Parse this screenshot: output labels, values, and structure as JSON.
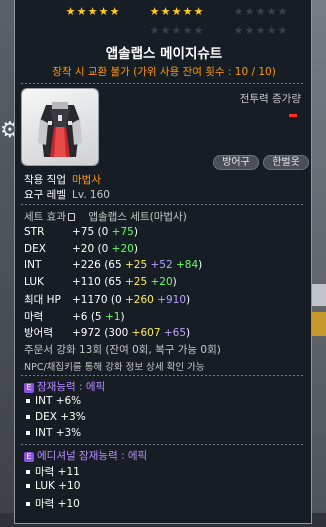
{
  "stars": {
    "row1": [
      1,
      1,
      1,
      1,
      1,
      1,
      1,
      1,
      1,
      1,
      0,
      0,
      0,
      0,
      0
    ],
    "row2": [
      0,
      0,
      0,
      0,
      0,
      0,
      0,
      0,
      0,
      0
    ]
  },
  "item": {
    "name": "앱솔랩스 메이지슈트",
    "trade_note": "장착 시 교환 불가 (가위 사용 잔여 횟수 : 10 / 10)",
    "power_label": "전투력 증가량",
    "tags": [
      "방어구",
      "한벌옷"
    ]
  },
  "requirements": {
    "job_label": "착용 직업",
    "job_value": "마법사",
    "level_label": "요구 레벨",
    "level_value": "Lv. 160"
  },
  "set": {
    "label": "세트 효과",
    "value": "앱솔랩스 세트(마법사)"
  },
  "stats": [
    {
      "name": "STR",
      "total": "+75",
      "open": "(0 ",
      "parts": [
        {
          "v": "+75",
          "c": "green"
        }
      ],
      "close": ")"
    },
    {
      "name": "DEX",
      "total": "+20",
      "open": "(0 ",
      "parts": [
        {
          "v": "+20",
          "c": "green"
        }
      ],
      "close": ")"
    },
    {
      "name": "INT",
      "total": "+226",
      "open": "(65 ",
      "parts": [
        {
          "v": "+25 ",
          "c": "yellow"
        },
        {
          "v": "+52 ",
          "c": "lav"
        },
        {
          "v": "+84",
          "c": "green"
        }
      ],
      "close": ")"
    },
    {
      "name": "LUK",
      "total": "+110",
      "open": "(65 ",
      "parts": [
        {
          "v": "+25 ",
          "c": "yellow"
        },
        {
          "v": "+20",
          "c": "green"
        }
      ],
      "close": ")"
    },
    {
      "name": "최대 HP",
      "total": "+1170",
      "open": "(0 ",
      "parts": [
        {
          "v": "+260 ",
          "c": "yellow"
        },
        {
          "v": "+910",
          "c": "lav"
        }
      ],
      "close": ")"
    },
    {
      "name": "마력",
      "total": "+6",
      "open": "(5 ",
      "parts": [
        {
          "v": "+1",
          "c": "green"
        }
      ],
      "close": ")"
    },
    {
      "name": "방어력",
      "total": "+972",
      "open": "(300 ",
      "parts": [
        {
          "v": "+607 ",
          "c": "yellow"
        },
        {
          "v": "+65",
          "c": "lav"
        }
      ],
      "close": ")"
    }
  ],
  "upgrade": {
    "line": "주문서 강화 13회 (잔여 0회, 복구 가능 0회)",
    "note": "NPC/채집키를 통해 강화 정보 상세 확인 가능"
  },
  "potential": {
    "badge": "E",
    "title": "잠재능력 : 에픽",
    "lines": [
      "INT +6%",
      "DEX +3%",
      "INT +3%"
    ]
  },
  "additional": {
    "badge": "E",
    "title": "에디셔널 잠재능력 : 에픽",
    "lines": [
      "마력 +11",
      "LUK +10",
      "마력 +10"
    ]
  },
  "colors": {
    "star_on": "#ffcc1e",
    "star_off": "#3b4047",
    "orange": "#ff9900",
    "green": "#66ff66",
    "yellow": "#ffee55",
    "lav": "#b8a4ff",
    "epic": "#b78cff"
  }
}
